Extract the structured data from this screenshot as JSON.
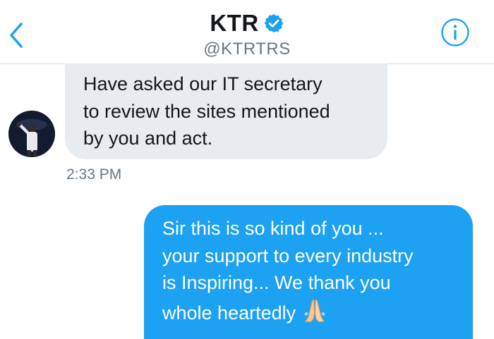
{
  "header": {
    "name": "KTR",
    "handle": "@KTRTRS",
    "icons": {
      "back": "chevron-left-icon",
      "verified": "verified-badge-icon",
      "info": "info-icon"
    },
    "colors": {
      "accent": "#1da1f2",
      "divider": "#d8dde2"
    }
  },
  "conversation": {
    "incoming": {
      "text": "Have asked our IT secretary\nto review the sites mentioned\nby you and act.",
      "timestamp": "2:33 PM",
      "bubble_color": "#e6ecf0"
    },
    "outgoing": {
      "text": "Sir this is so kind of you ...\nyour support to every industry\nis Inspiring... We thank you\nwhole heartedly",
      "emoji": "folded-hands-emoji",
      "bubble_color": "#1da1f2"
    }
  }
}
